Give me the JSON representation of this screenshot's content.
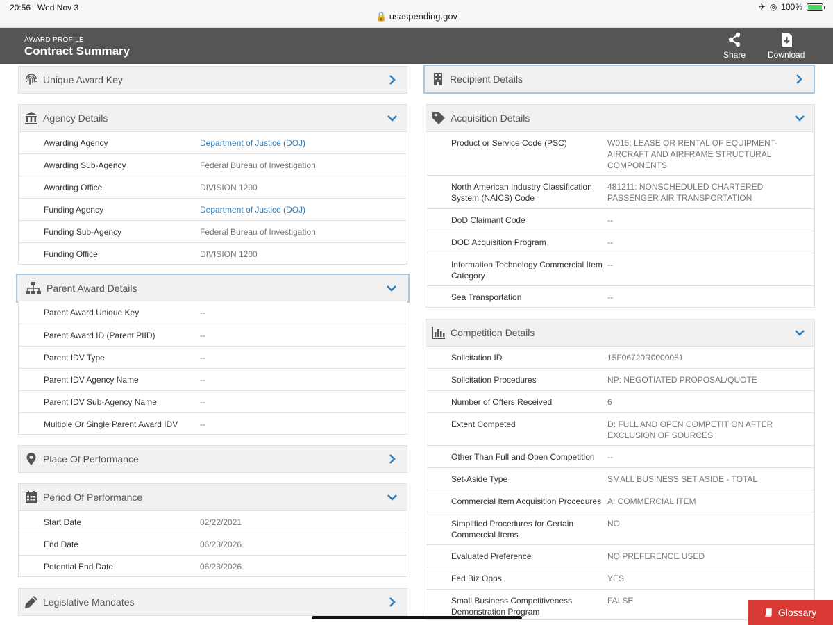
{
  "status": {
    "time": "20:56",
    "date": "Wed Nov 3",
    "battery": "100%",
    "battery_level": 1.0
  },
  "browser": {
    "url": "usaspending.gov"
  },
  "header": {
    "kicker": "AWARD PROFILE",
    "title": "Contract Summary",
    "share_label": "Share",
    "download_label": "Download"
  },
  "left": {
    "unique_award_key": {
      "title": "Unique Award Key"
    },
    "agency": {
      "title": "Agency Details",
      "rows": [
        {
          "label": "Awarding Agency",
          "value": "Department of Justice (DOJ)"
        },
        {
          "label": "Awarding Sub-Agency",
          "value": "Federal Bureau of Investigation"
        },
        {
          "label": "Awarding Office",
          "value": "DIVISION 1200"
        },
        {
          "label": "Funding Agency",
          "value": "Department of Justice (DOJ)"
        },
        {
          "label": "Funding Sub-Agency",
          "value": "Federal Bureau of Investigation"
        },
        {
          "label": "Funding Office",
          "value": "DIVISION 1200"
        }
      ]
    },
    "parent": {
      "title": "Parent Award Details",
      "rows": [
        {
          "label": "Parent Award Unique Key",
          "value": "--"
        },
        {
          "label": "Parent Award ID (Parent PIID)",
          "value": "--"
        },
        {
          "label": "Parent IDV Type",
          "value": "--"
        },
        {
          "label": "Parent IDV Agency Name",
          "value": "--"
        },
        {
          "label": "Parent IDV Sub-Agency Name",
          "value": "--"
        },
        {
          "label": "Multiple Or Single Parent Award IDV",
          "value": "--"
        }
      ]
    },
    "place": {
      "title": "Place Of Performance"
    },
    "period": {
      "title": "Period Of Performance",
      "rows": [
        {
          "label": "Start Date",
          "value": "02/22/2021"
        },
        {
          "label": "End Date",
          "value": "06/23/2026"
        },
        {
          "label": "Potential End Date",
          "value": "06/23/2026"
        }
      ]
    },
    "legislative": {
      "title": "Legislative Mandates"
    }
  },
  "right": {
    "recipient": {
      "title": "Recipient Details"
    },
    "acquisition": {
      "title": "Acquisition Details",
      "rows": [
        {
          "label": "Product or Service Code (PSC)",
          "value": "W015: LEASE OR RENTAL OF EQUIPMENT- AIRCRAFT AND AIRFRAME STRUCTURAL COMPONENTS"
        },
        {
          "label": "North American Industry Classification System (NAICS) Code",
          "value": "481211: NONSCHEDULED CHARTERED PASSENGER AIR TRANSPORTATION"
        },
        {
          "label": "DoD Claimant Code",
          "value": "--"
        },
        {
          "label": "DOD Acquisition Program",
          "value": "--"
        },
        {
          "label": "Information Technology Commercial Item Category",
          "value": "--"
        },
        {
          "label": "Sea Transportation",
          "value": "--"
        }
      ]
    },
    "competition": {
      "title": "Competition Details",
      "rows": [
        {
          "label": "Solicitation ID",
          "value": "15F06720R0000051"
        },
        {
          "label": "Solicitation Procedures",
          "value": "NP: NEGOTIATED PROPOSAL/QUOTE"
        },
        {
          "label": "Number of Offers Received",
          "value": "6"
        },
        {
          "label": "Extent Competed",
          "value": "D: FULL AND OPEN COMPETITION AFTER EXCLUSION OF SOURCES"
        },
        {
          "label": "Other Than Full and Open Competition",
          "value": "--"
        },
        {
          "label": "Set-Aside Type",
          "value": "SMALL BUSINESS SET ASIDE - TOTAL"
        },
        {
          "label": "Commercial Item Acquisition Procedures",
          "value": "A: COMMERCIAL ITEM"
        },
        {
          "label": "Simplified Procedures for Certain Commercial Items",
          "value": "NO"
        },
        {
          "label": "Evaluated Preference",
          "value": "NO PREFERENCE USED"
        },
        {
          "label": "Fed Biz Opps",
          "value": "YES"
        },
        {
          "label": "Small Business Competitiveness Demonstration Program",
          "value": "FALSE"
        }
      ]
    }
  },
  "glossary": {
    "label": "Glossary"
  }
}
